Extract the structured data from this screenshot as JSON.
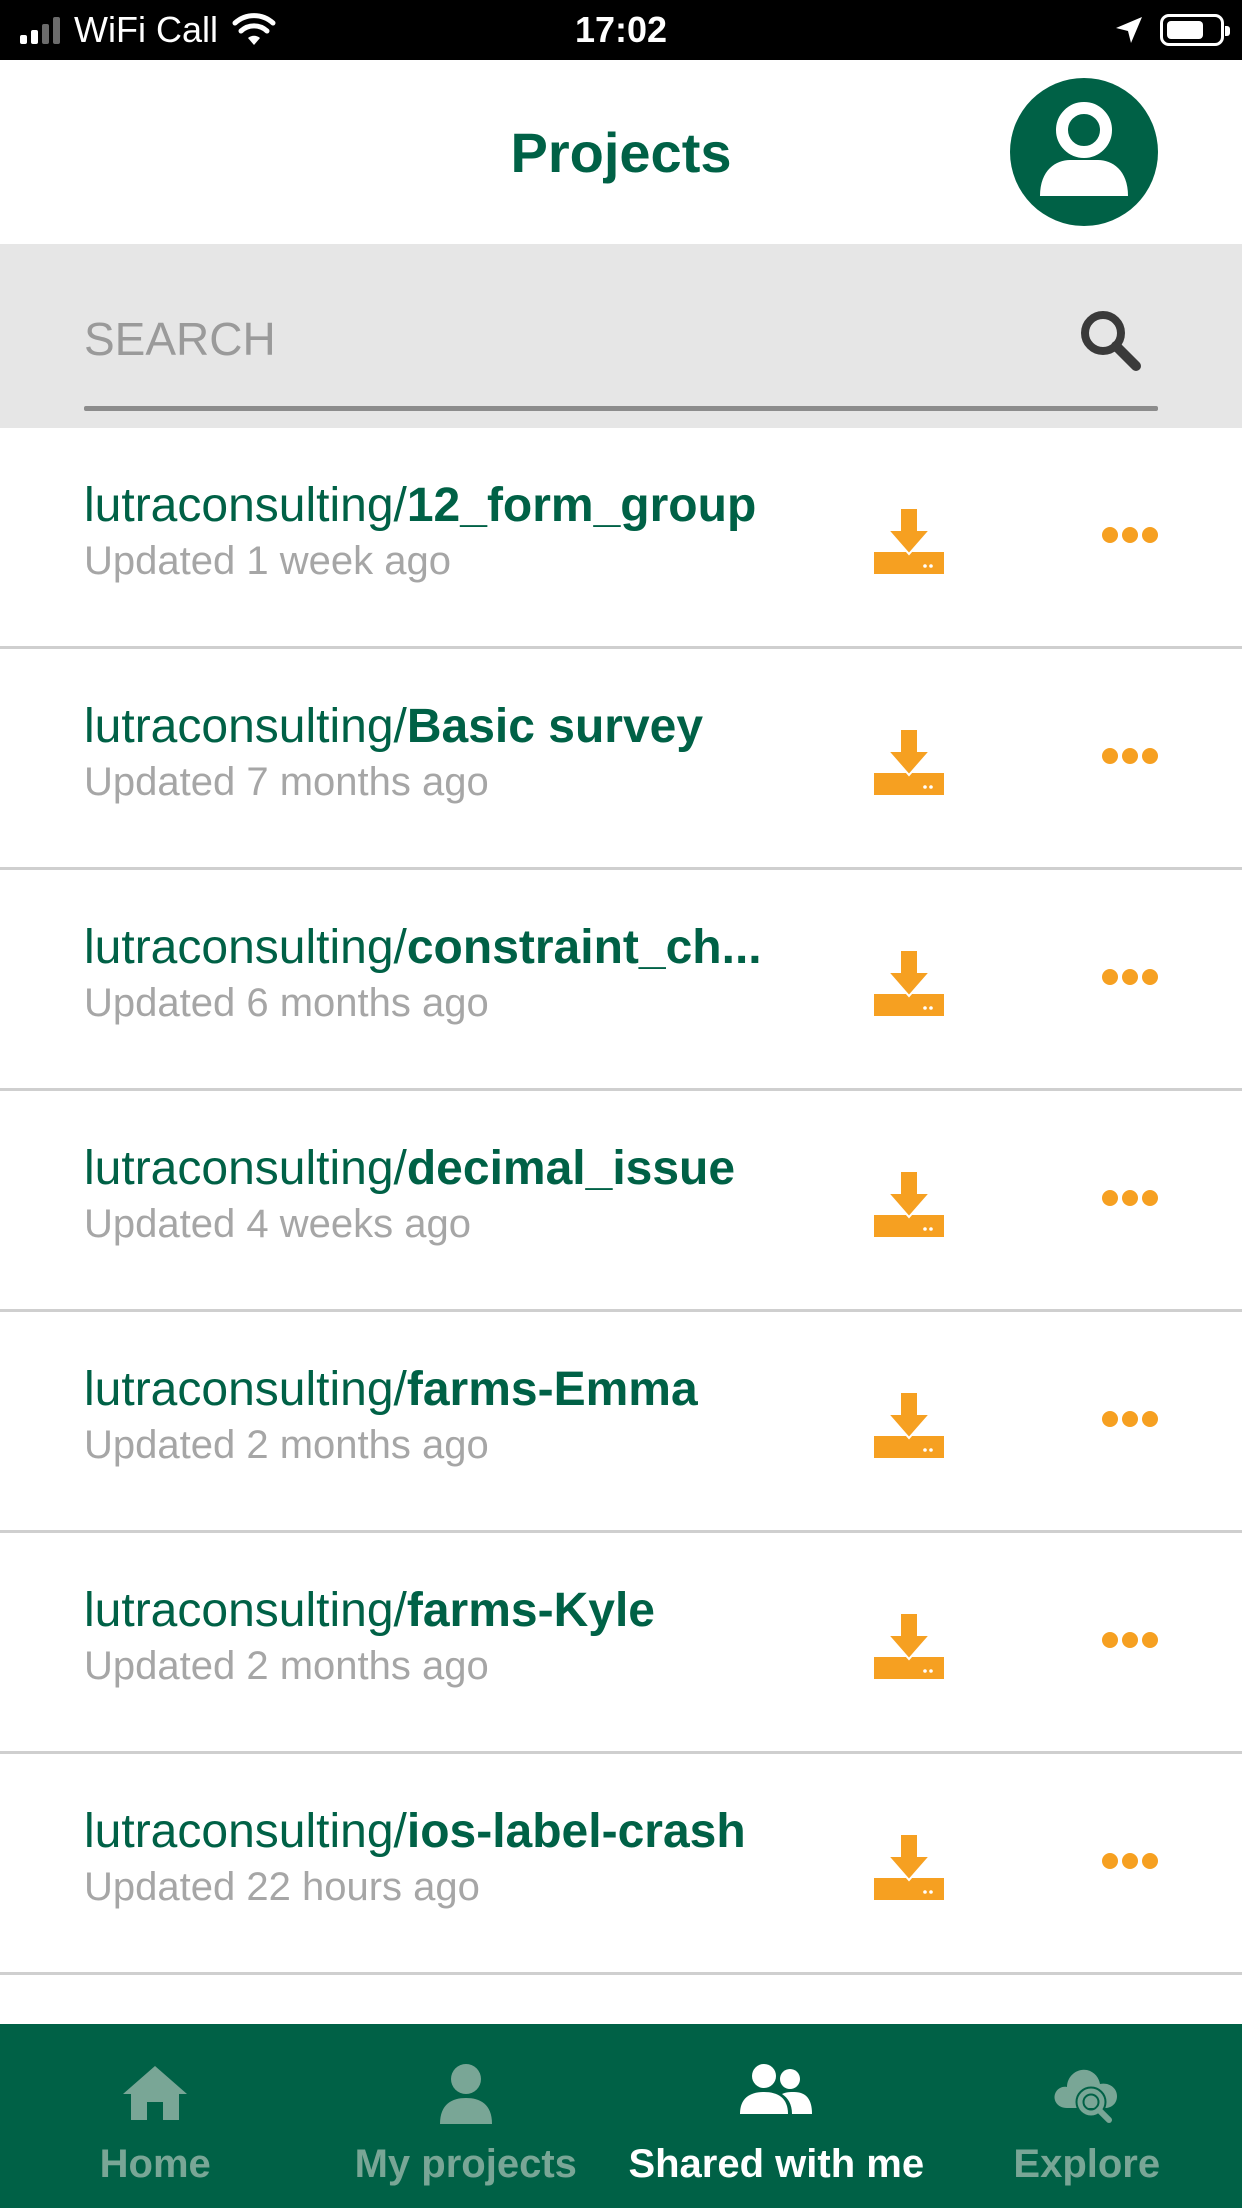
{
  "status_bar": {
    "carrier": "WiFi Call",
    "time": "17:02",
    "icons": [
      "signal-icon",
      "wifi-icon",
      "location-arrow-icon",
      "battery-icon"
    ]
  },
  "header": {
    "title": "Projects",
    "avatar_icon": "user-avatar-icon"
  },
  "search": {
    "placeholder": "SEARCH",
    "icon": "search-icon"
  },
  "projects": [
    {
      "namespace": "lutraconsulting/",
      "name": "12_form_group",
      "updated": "Updated 1 week ago"
    },
    {
      "namespace": "lutraconsulting/",
      "name": "Basic survey",
      "updated": "Updated 7 months ago"
    },
    {
      "namespace": "lutraconsulting/",
      "name": "constraint_ch...",
      "updated": "Updated 6 months ago"
    },
    {
      "namespace": "lutraconsulting/",
      "name": "decimal_issue",
      "updated": "Updated 4 weeks ago"
    },
    {
      "namespace": "lutraconsulting/",
      "name": "farms-Emma",
      "updated": "Updated 2 months ago"
    },
    {
      "namespace": "lutraconsulting/",
      "name": "farms-Kyle",
      "updated": "Updated 2 months ago"
    },
    {
      "namespace": "lutraconsulting/",
      "name": "ios-label-crash",
      "updated": "Updated 22 hours ago"
    }
  ],
  "row_icons": {
    "download": "download-icon",
    "more": "more-options-icon"
  },
  "bottom_nav": {
    "items": [
      {
        "label": "Home",
        "icon": "home-icon",
        "active": false
      },
      {
        "label": "My projects",
        "icon": "person-icon",
        "active": false
      },
      {
        "label": "Shared with me",
        "icon": "people-icon",
        "active": true
      },
      {
        "label": "Explore",
        "icon": "cloud-search-icon",
        "active": false
      }
    ]
  },
  "colors": {
    "brand_green": "#006146",
    "accent_orange": "#f6a021",
    "muted_text": "#a6a6a6",
    "search_bg": "#e6e6e6",
    "nav_inactive": "#79a696"
  }
}
